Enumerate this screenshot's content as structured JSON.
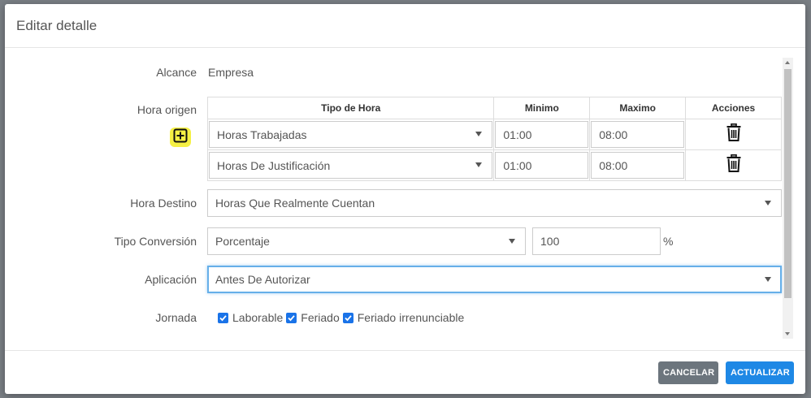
{
  "modal": {
    "title": "Editar detalle"
  },
  "form": {
    "alcance": {
      "label": "Alcance",
      "value": "Empresa"
    },
    "hora_origen": {
      "label": "Hora origen",
      "columns": [
        "Tipo de Hora",
        "Minimo",
        "Maximo",
        "Acciones"
      ],
      "rows": [
        {
          "tipo": "Horas Trabajadas",
          "minimo": "01:00",
          "maximo": "08:00"
        },
        {
          "tipo": "Horas De Justificación",
          "minimo": "01:00",
          "maximo": "08:00"
        }
      ]
    },
    "hora_destino": {
      "label": "Hora Destino",
      "value": "Horas Que Realmente Cuentan"
    },
    "tipo_conversion": {
      "label": "Tipo Conversión",
      "value": "Porcentaje",
      "amount": "100",
      "unit": "%"
    },
    "aplicacion": {
      "label": "Aplicación",
      "value": "Antes De Autorizar"
    },
    "jornada": {
      "label": "Jornada",
      "options": [
        {
          "label": "Laborable",
          "checked": true
        },
        {
          "label": "Feriado",
          "checked": true
        },
        {
          "label": "Feriado irrenunciable",
          "checked": true
        }
      ]
    }
  },
  "footer": {
    "cancel_label": "CANCELAR",
    "update_label": "ACTUALIZAR"
  },
  "colors": {
    "primary": "#1e88e5",
    "secondary": "#6c757d",
    "highlight": "#f5f044",
    "checkbox": "#1a73e8"
  }
}
